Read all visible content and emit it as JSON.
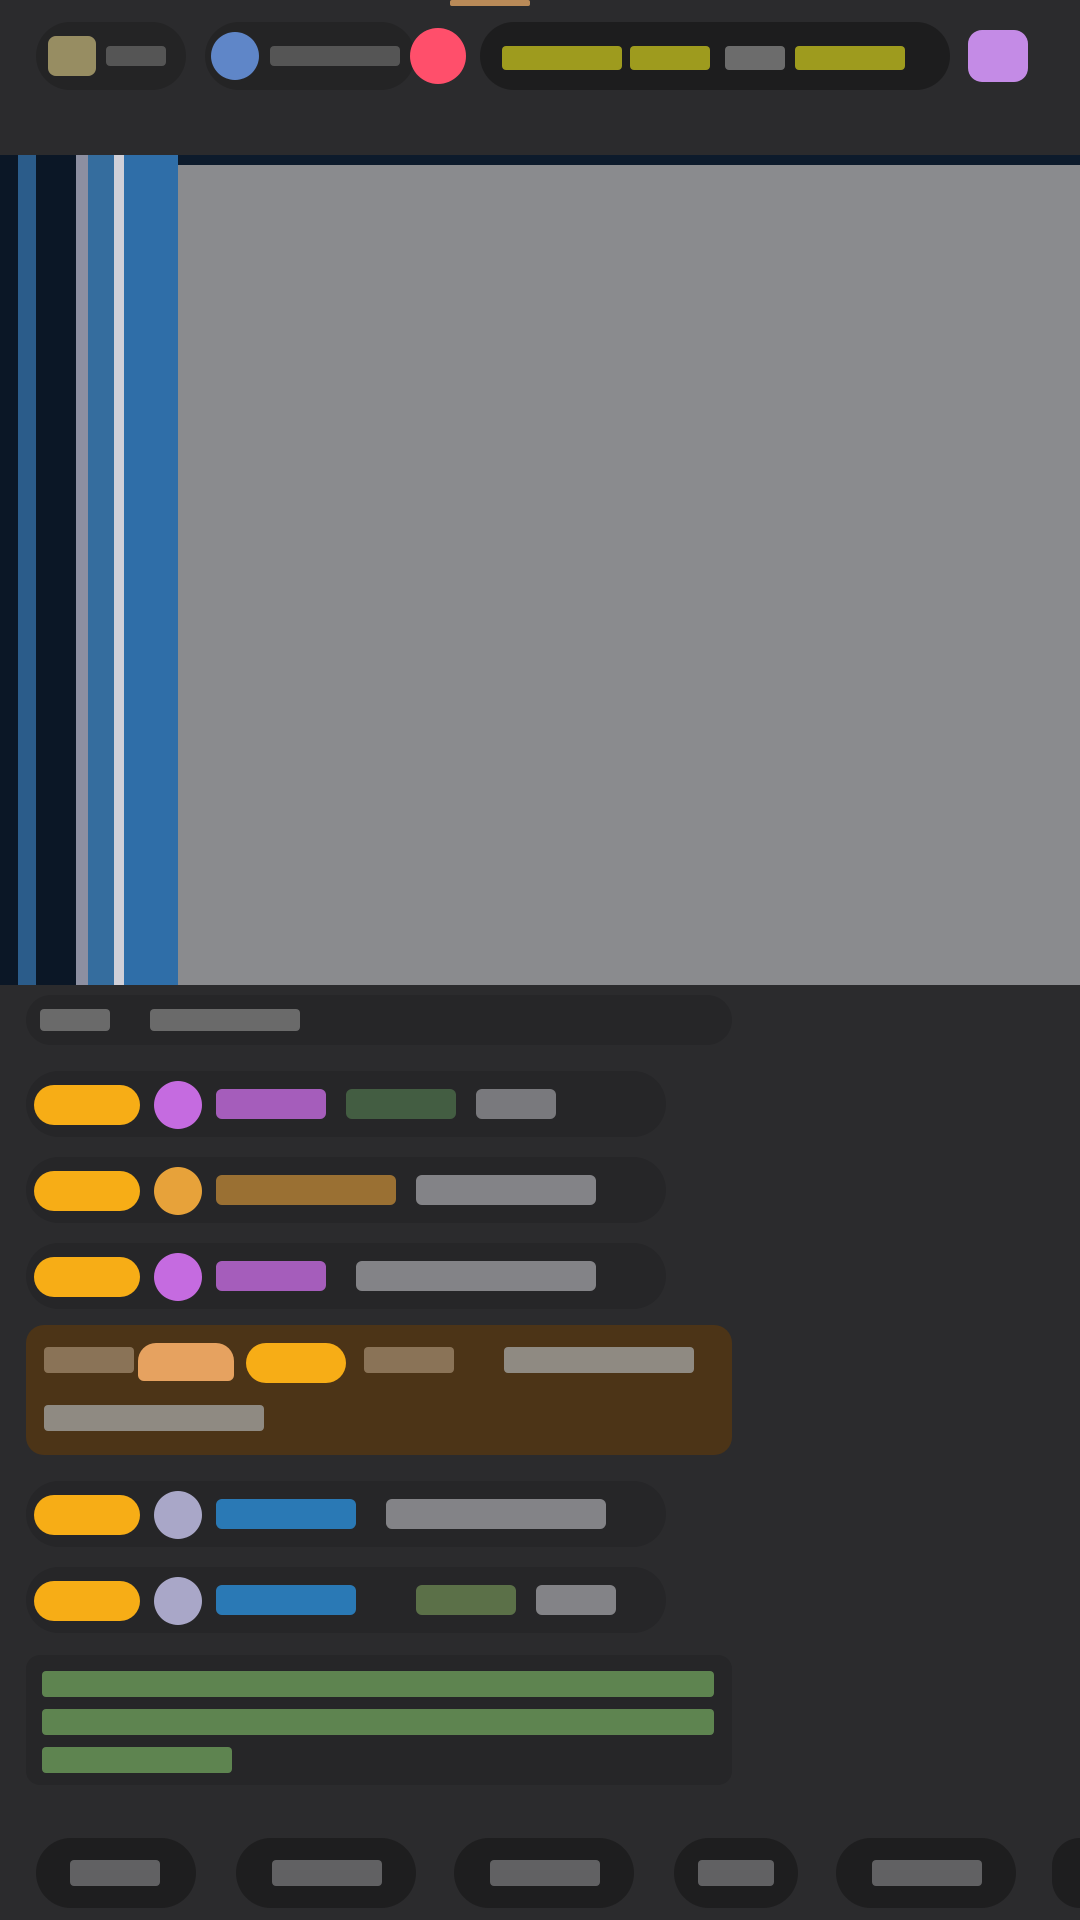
{
  "topbar": {
    "streamer_pill": {
      "color": "#c9bb7c"
    },
    "viewer_pill": {
      "color": "#5f86c8"
    },
    "live_dot": {
      "color": "#ff4f6b"
    },
    "ticker": {
      "color": "#c9c51f"
    },
    "gift_icon": {
      "color": "#c48be6"
    }
  },
  "video": {
    "placeholder_color": "#8a8b8e",
    "stripe_colors": [
      "#0b1726",
      "#2b5c8a",
      "#0b1726",
      "#8c8fa1",
      "#356d9e",
      "#d0d0d8",
      "#2f6ea8"
    ]
  },
  "chat": {
    "badge_color": "#f7ad16",
    "name_colors": {
      "purple": "#c56be0",
      "orange": "#e7a23a",
      "blue": "#2c8fd8",
      "green": "#7ea25d"
    },
    "system_message_color": "#83c36a",
    "highlight_row_color": "#4c3417"
  },
  "bottom_bar": {
    "chip_color": "#1e1e1f"
  }
}
